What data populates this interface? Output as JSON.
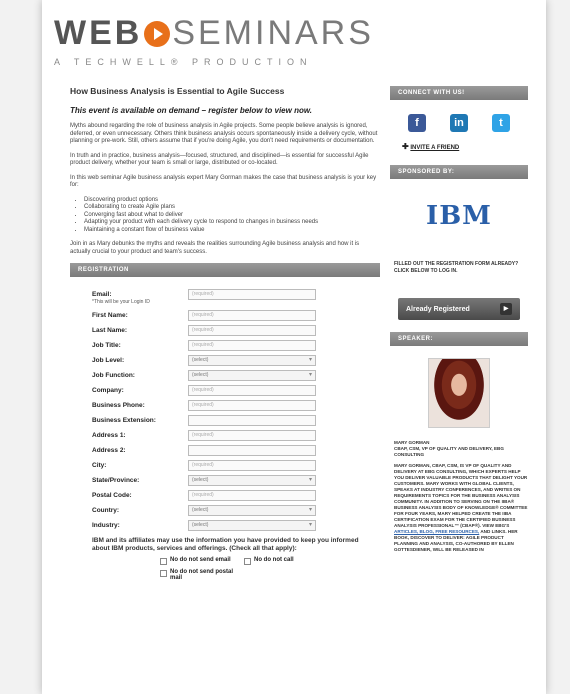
{
  "logo": {
    "web": "WEB",
    "seminars": "SEMINARS",
    "tagline": "A TECHWELL® PRODUCTION"
  },
  "main": {
    "title": "How Business Analysis is Essential to Agile Success",
    "subtitle": "This event is available on demand – register below to view now.",
    "paragraphs": [
      "Myths abound regarding the role of business analysis in Agile projects. Some people believe analysis is ignored, deferred, or even unnecessary. Others think business analysis occurs spontaneously inside a delivery cycle, without planning or pre-work. Still, others assume that if you're doing Agile, you don't need requirements or documentation.",
      "In truth and in practice, business analysis—focused, structured, and disciplined—is essential for successful Agile product delivery, whether your team is small or large, distributed or co-located.",
      "In this web seminar Agile business analysis expert Mary Gorman makes the case that business analysis is your key for:"
    ],
    "bullets": [
      "Discovering product options",
      "Collaborating to create Agile plans",
      "Converging fast about what to deliver",
      "Adapting your product with each delivery cycle to respond to changes in business needs",
      "Maintaining a constant flow of business value"
    ],
    "closing": "Join in as Mary debunks the myths and reveals the realities surrounding Agile business analysis and how it is actually crucial to your product and team's success."
  },
  "registration": {
    "header": "REGISTRATION",
    "note": "*This will be your Login ID",
    "fields": [
      {
        "label": "Email:",
        "value": "(required)",
        "kind": "input"
      },
      {
        "label": "First Name:",
        "value": "(required)",
        "kind": "input"
      },
      {
        "label": "Last Name:",
        "value": "(required)",
        "kind": "input"
      },
      {
        "label": "Job Title:",
        "value": "(required)",
        "kind": "input"
      },
      {
        "label": "Job Level:",
        "value": "(select)",
        "kind": "select"
      },
      {
        "label": "Job Function:",
        "value": "(select)",
        "kind": "select"
      },
      {
        "label": "Company:",
        "value": "(required)",
        "kind": "input"
      },
      {
        "label": "Business Phone:",
        "value": "(required)",
        "kind": "input"
      },
      {
        "label": "Business Extension:",
        "value": "",
        "kind": "input"
      },
      {
        "label": "Address 1:",
        "value": "(required)",
        "kind": "input"
      },
      {
        "label": "Address 2:",
        "value": "",
        "kind": "input"
      },
      {
        "label": "City:",
        "value": "(required)",
        "kind": "input"
      },
      {
        "label": "State/Province:",
        "value": "(select)",
        "kind": "select"
      },
      {
        "label": "Postal Code:",
        "value": "(required)",
        "kind": "input"
      },
      {
        "label": "Country:",
        "value": "(select)",
        "kind": "select"
      },
      {
        "label": "Industry:",
        "value": "(select)",
        "kind": "select"
      }
    ],
    "consent": "IBM and its affiliates may use the information you have provided to keep you informed about IBM products, services and offerings. (Check all that apply):",
    "checks": [
      "No do not send email",
      "No do not call",
      "No do not send postal mail"
    ]
  },
  "sidebar": {
    "connect_header": "CONNECT WITH US!",
    "social": [
      {
        "glyph": "f",
        "color": "#3b5998",
        "icon": "facebook-icon"
      },
      {
        "glyph": "in",
        "color": "#1f78b4",
        "icon": "linkedin-icon"
      },
      {
        "glyph": "t",
        "color": "#2fa3e6",
        "icon": "twitter-icon"
      }
    ],
    "invite": "INVITE A FRIEND",
    "sponsored_header": "SPONSORED BY:",
    "sponsor": "IBM",
    "filled_out": "FILLED OUT THE REGISTRATION FORM ALREADY?",
    "click_below": "CLICK BELOW TO LOG IN.",
    "registered_button": "Already Registered",
    "speaker_header": "SPEAKER:",
    "speaker_name": "MARY GORMAN",
    "speaker_title": "CBAP, CSM, VP OF QUALITY AND DELIVERY, EBG CONSULTING",
    "bio_1": "MARY GORMAN, CBAP, CSM, IS VP OF QUALITY AND DELIVERY AT EBG CONSULTING, WHICH EXPERTS HELP YOU DELIVER VALUABLE PRODUCTS THAT DELIGHT YOUR CUSTOMERS. MARY WORKS WITH GLOBAL CLIENTS, SPEAKS AT INDUSTRY CONFERENCES, AND WRITES ON REQUIREMENTS TOPICS FOR THE BUSINESS ANALYSIS COMMUNITY. IN ADDITION TO SERVING ON THE IIBA® BUSINESS ANALYSIS BODY OF KNOWLEDGE® COMMITTEE FOR FOUR YEARS, MARY HELPED CREATE THE IIBA CERTIFICATION EXAM FOR THE CERTIFIED BUSINESS ANALYSIS PROFESSIONAL™ (CBAP®). VIEW EBG'S",
    "bio_link": "ARTICLES, BLOG, FREE RESOURCES,",
    "bio_2": "AND LINKS. HER BOOK, DISCOVER TO DELIVER: AGILE PRODUCT PLANNING AND ANALYSIS, CO-AUTHORED BY ELLEN GOTTESDIENER, WILL BE RELEASED IN"
  }
}
